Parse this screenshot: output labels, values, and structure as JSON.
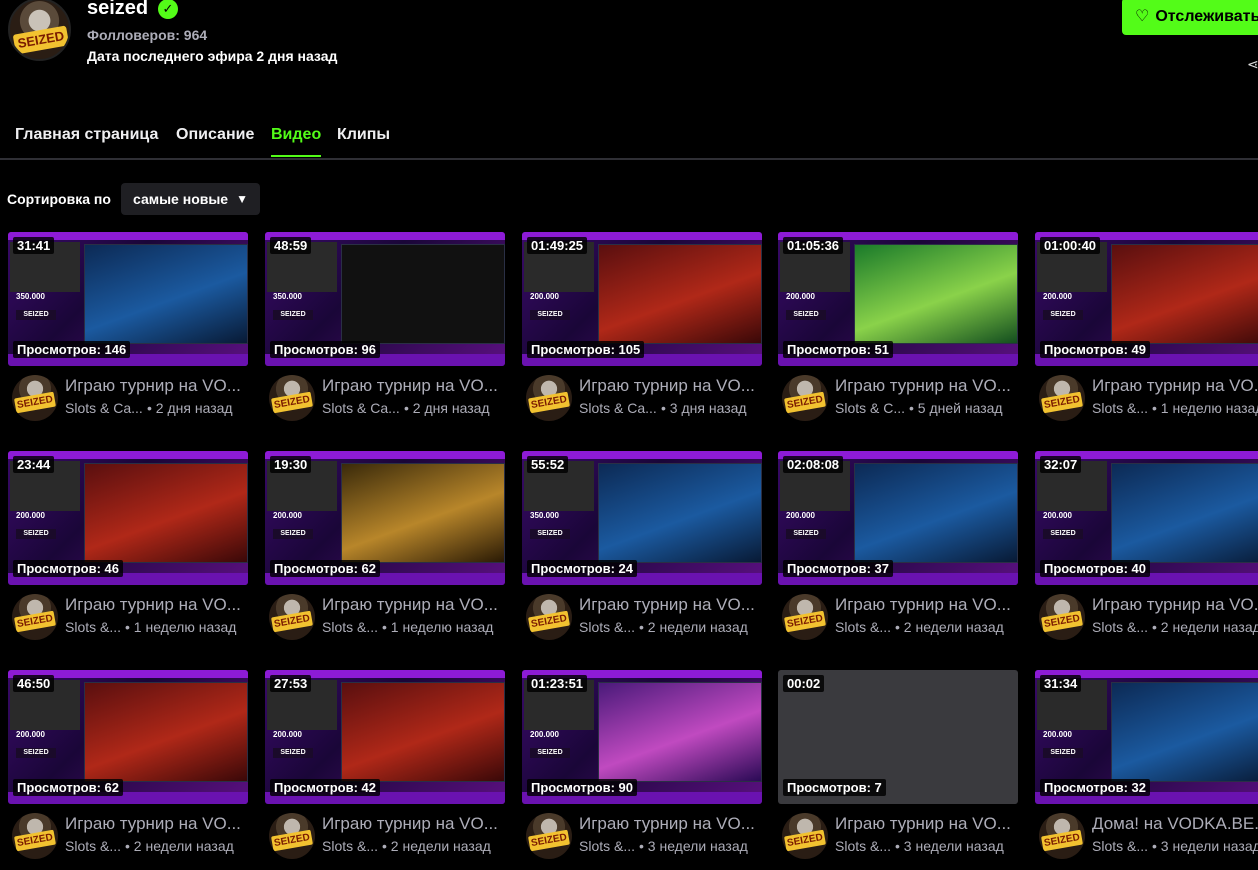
{
  "channel": {
    "name": "seized",
    "avatar_tag": "SEIZED",
    "followers": "Фолловеров: 964",
    "last_stream": "Дата последнего эфира 2 дня назад",
    "follow_label": "Отслеживать"
  },
  "tabs": [
    {
      "label": "Главная страница",
      "active": false
    },
    {
      "label": "Описание",
      "active": false
    },
    {
      "label": "Видео",
      "active": true
    },
    {
      "label": "Клипы",
      "active": false
    }
  ],
  "sort": {
    "label": "Сортировка по",
    "value": "самые новые"
  },
  "videos": [
    {
      "duration": "31:41",
      "views": "Просмотров: 146",
      "title": "Играю турнир на VO...",
      "category": "Slots & Ca...",
      "age": "• 2 дня назад",
      "thumb": "blue",
      "side_val": "350.000"
    },
    {
      "duration": "48:59",
      "views": "Просмотров: 96",
      "title": "Играю турнир на VO...",
      "category": "Slots & Ca...",
      "age": "• 2 дня назад",
      "thumb": "dark",
      "side_val": "350.000"
    },
    {
      "duration": "01:49:25",
      "views": "Просмотров: 105",
      "title": "Играю турнир на VO...",
      "category": "Slots & Ca...",
      "age": "• 3 дня назад",
      "thumb": "red",
      "side_val": "200.000"
    },
    {
      "duration": "01:05:36",
      "views": "Просмотров: 51",
      "title": "Играю турнир на VO...",
      "category": "Slots & C...",
      "age": "• 5 дней назад",
      "thumb": "green",
      "side_val": "200.000"
    },
    {
      "duration": "01:00:40",
      "views": "Просмотров: 49",
      "title": "Играю турнир на VO...",
      "category": "Slots &...",
      "age": "• 1 неделю назад",
      "thumb": "red",
      "side_val": "200.000"
    },
    {
      "duration": "23:44",
      "views": "Просмотров: 46",
      "title": "Играю турнир на VO...",
      "category": "Slots &...",
      "age": "• 1 неделю назад",
      "thumb": "red",
      "side_val": "200.000"
    },
    {
      "duration": "19:30",
      "views": "Просмотров: 62",
      "title": "Играю турнир на VO...",
      "category": "Slots &...",
      "age": "• 1 неделю назад",
      "thumb": "gold",
      "side_val": "200.000"
    },
    {
      "duration": "55:52",
      "views": "Просмотров: 24",
      "title": "Играю турнир на VO...",
      "category": "Slots &...",
      "age": "• 2 недели назад",
      "thumb": "blue",
      "side_val": "350.000"
    },
    {
      "duration": "02:08:08",
      "views": "Просмотров: 37",
      "title": "Играю турнир на VO...",
      "category": "Slots &...",
      "age": "• 2 недели назад",
      "thumb": "blue",
      "side_val": "200.000"
    },
    {
      "duration": "32:07",
      "views": "Просмотров: 40",
      "title": "Играю турнир на VO...",
      "category": "Slots &...",
      "age": "• 2 недели назад",
      "thumb": "blue",
      "side_val": "200.000"
    },
    {
      "duration": "46:50",
      "views": "Просмотров: 62",
      "title": "Играю турнир на VO...",
      "category": "Slots &...",
      "age": "• 2 недели назад",
      "thumb": "red",
      "side_val": "200.000"
    },
    {
      "duration": "27:53",
      "views": "Просмотров: 42",
      "title": "Играю турнир на VO...",
      "category": "Slots &...",
      "age": "• 2 недели назад",
      "thumb": "red",
      "side_val": "200.000"
    },
    {
      "duration": "01:23:51",
      "views": "Просмотров: 90",
      "title": "Играю турнир на VO...",
      "category": "Slots &...",
      "age": "• 3 недели назад",
      "thumb": "pink",
      "side_val": "200.000"
    },
    {
      "duration": "00:02",
      "views": "Просмотров: 7",
      "title": "Играю турнир на VO...",
      "category": "Slots &...",
      "age": "• 3 недели назад",
      "thumb": "grey",
      "side_val": ""
    },
    {
      "duration": "31:34",
      "views": "Просмотров: 32",
      "title": "Дома! на VODKA.BE...",
      "category": "Slots &...",
      "age": "• 3 недели назад",
      "thumb": "blue",
      "side_val": "200.000"
    }
  ]
}
